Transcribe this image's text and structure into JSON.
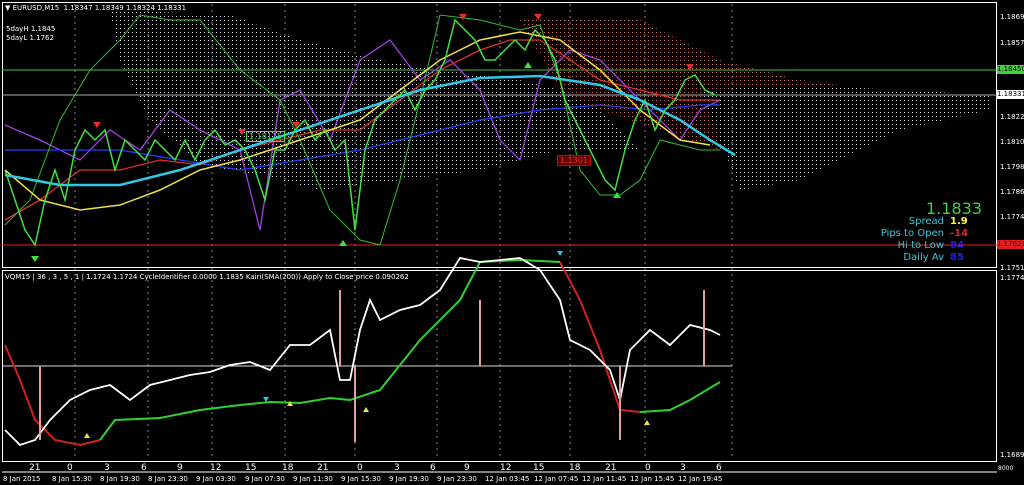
{
  "header": {
    "symbol": "EURUSD,M15",
    "ohlc": "1.18347 1.18349 1.18324 1.18331",
    "five_day_high": "5dayH 1.1845",
    "five_day_low": "5dayL 1.1762"
  },
  "price_axis": [
    "1.18695",
    "1.18575",
    "1.18450",
    "1.18331",
    "1.18220",
    "1.18100",
    "1.17985",
    "1.17865",
    "1.17745",
    "1.17621",
    "1.17510"
  ],
  "tags": {
    "high_line": "1.18450",
    "current": "1.18331",
    "low_line": "1.17621",
    "box_green": "1.18125",
    "box_red": "1.1301"
  },
  "info": {
    "price": "1.1833",
    "spread_label": "Spread",
    "spread_value": "1.9",
    "pips_label": "Pips to Open",
    "pips_value": "-14",
    "hilo_label": "Hi to Low",
    "hilo_value": "84",
    "daily_label": "Daily Av",
    "daily_value": "85"
  },
  "colors": {
    "spread": "#ffff40",
    "pips": "#e02020",
    "hilo": "#2020e0",
    "daily": "#2020e0",
    "price": "#40d040",
    "label": "#3cc6d8"
  },
  "sub_panel": {
    "caption": "VQM15 | 36 , 3 , 5 , 1 | 1.1724 1.1724 CycleIdentifier 0.0000 1.1835 Kairi(SMA(200)) Apply to Close price 0.090262",
    "axis_top": "1.1774",
    "axis_bottom": "1.1689",
    "corner": "8000"
  },
  "hours": [
    "21",
    "0",
    "3",
    "6",
    "9",
    "12",
    "15",
    "18",
    "21",
    "0",
    "3",
    "6",
    "9",
    "12",
    "15",
    "18",
    "21",
    "0",
    "3",
    "6"
  ],
  "times": [
    "8 Jan 2015",
    "8 Jan 15:30",
    "8 Jan 19:30",
    "8 Jan 23:30",
    "9 Jan 03:30",
    "9 Jan 07:30",
    "9 Jan 11:30",
    "9 Jan 15:30",
    "9 Jan 19:30",
    "9 Jan 23:30",
    "12 Jan 03:45",
    "12 Jan 07:45",
    "12 Jan 11:45",
    "12 Jan 15:45",
    "12 Jan 19:45"
  ]
}
